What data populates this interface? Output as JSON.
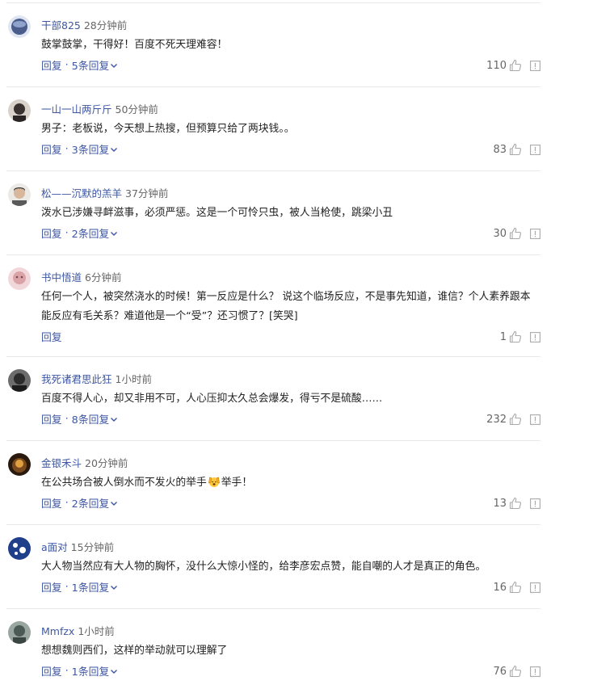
{
  "labels": {
    "reply": "回复",
    "sep": "·"
  },
  "comments": [
    {
      "username": "干部825",
      "time": "28分钟前",
      "text": "鼓掌鼓掌，干得好！百度不死天理难容！",
      "replies": "5条回复",
      "likes": "110",
      "avatar_color": "#4a5e8c"
    },
    {
      "username": "一山一山两斤斤",
      "time": "50分钟前",
      "text": "男子：老板说，今天想上热搜，但预算只给了两块钱。。",
      "replies": "3条回复",
      "likes": "83",
      "avatar_color": "#3a3230"
    },
    {
      "username": "松——沉默的羔羊",
      "time": "37分钟前",
      "text": "泼水已涉嫌寻衅滋事，必须严惩。这是一个可怜只虫，被人当枪使，跳梁小丑",
      "replies": "2条回复",
      "likes": "30",
      "avatar_color": "#d8d4cf"
    },
    {
      "username": "书中悟道",
      "time": "6分钟前",
      "text": "任何一个人，被突然浇水的时候！第一反应是什么？ 说这个临场反应，不是事先知道，谁信？个人素养跟本能反应有毛关系？难道他是一个“受”？还习惯了？[笑哭]",
      "replies": "",
      "likes": "1",
      "avatar_color": "#d9a3a8"
    },
    {
      "username": "我死诸君思此狂",
      "time": "1小时前",
      "text": "百度不得人心，却又非用不可，人心压抑太久总会爆发，得亏不是硫酸……",
      "replies": "8条回复",
      "likes": "232",
      "avatar_color": "#2c2c2c"
    },
    {
      "username": "金银禾斗",
      "time": "20分钟前",
      "text_before": "在公共场合被人倒水而不发火的举手",
      "text_after": "举手！",
      "replies": "2条回复",
      "likes": "13",
      "avatar_color": "#7a4a1e"
    },
    {
      "username": "a面对",
      "time": "15分钟前",
      "text": "大人物当然应有大人物的胸怀，没什么大惊小怪的，给李彦宏点赞，能自嘲的人才是真正的角色。",
      "replies": "1条回复",
      "likes": "16",
      "avatar_color": "#1f3f8a"
    },
    {
      "username": "Mmfzx",
      "time": "1小时前",
      "text": "想想魏则西们，这样的举动就可以理解了",
      "replies": "1条回复",
      "likes": "76",
      "avatar_color": "#4b5a55"
    }
  ]
}
